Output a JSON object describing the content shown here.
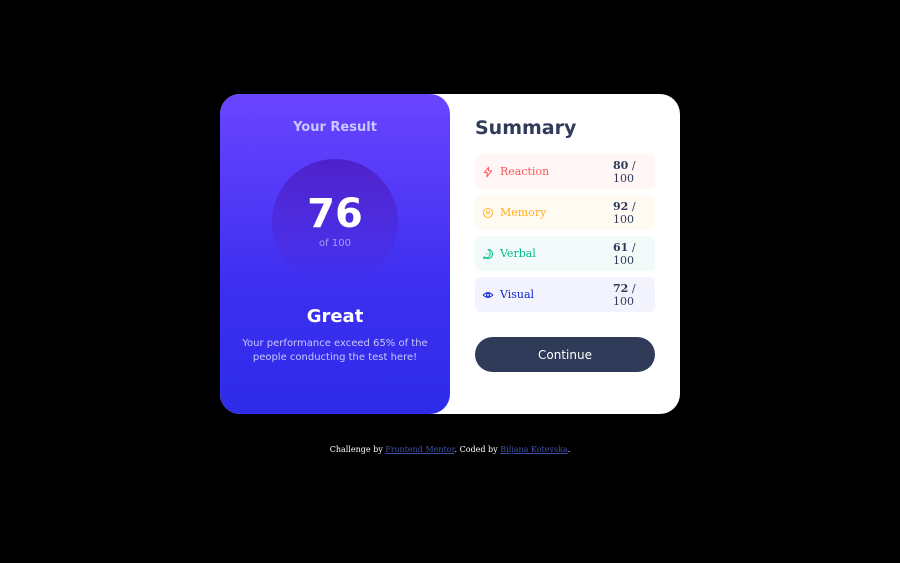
{
  "result": {
    "title": "Your Result",
    "score": "76",
    "score_of": "of 100",
    "rating": "Great",
    "description": "Your performance exceed 65% of the people conducting the test here!"
  },
  "summary": {
    "title": "Summary",
    "items": [
      {
        "label": "Reaction",
        "score": "80",
        "max": "/ 100",
        "color": "#ff5757",
        "icon": "lightning-icon"
      },
      {
        "label": "Memory",
        "score": "92",
        "max": "/ 100",
        "color": "#ffb01f",
        "icon": "brain-icon"
      },
      {
        "label": "Verbal",
        "score": "61",
        "max": "/ 100",
        "color": "#00bb8f",
        "icon": "chat-bubble-icon"
      },
      {
        "label": "Visual",
        "score": "72",
        "max": "/ 100",
        "color": "#1125d4",
        "icon": "eye-icon"
      }
    ],
    "continue_label": "Continue"
  },
  "attribution": {
    "prefix": "Challenge by",
    "link1": "Frontend Mentor",
    "middle": ". Coded by",
    "link2": "Biljana Kotevska",
    "suffix": "."
  }
}
